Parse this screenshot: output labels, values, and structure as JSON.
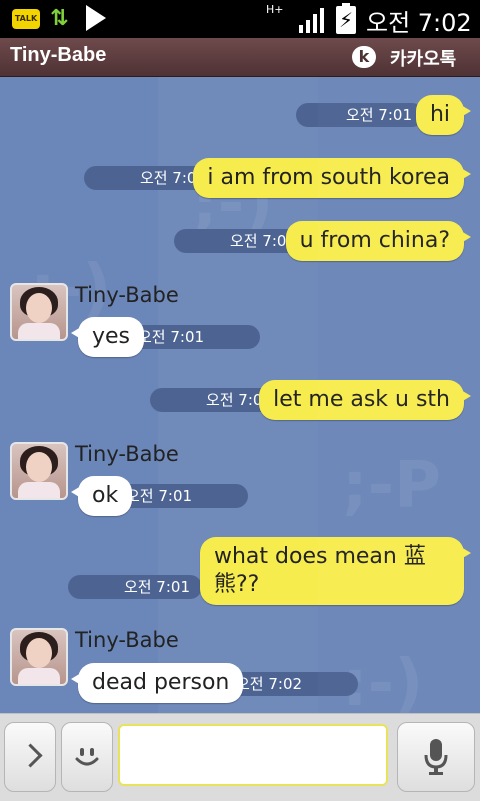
{
  "status_bar": {
    "talk_label": "TALK",
    "network": "H+",
    "time": "오전 7:02",
    "icons": [
      "kakaotalk-notification-icon",
      "sync-icon",
      "play-icon",
      "network-type-icon",
      "signal-icon",
      "battery-charging-icon"
    ]
  },
  "header": {
    "title": "Tiny-Babe",
    "brand": "카카오톡",
    "brand_icon": "kakao-logo-icon"
  },
  "watermarks": [
    ";-)",
    ";-)",
    ";-P",
    ":-)"
  ],
  "messages": [
    {
      "dir": "sent",
      "text": "hi",
      "time": "오전 7:01"
    },
    {
      "dir": "sent",
      "text": "i am from south korea",
      "time": "오전 7:01"
    },
    {
      "dir": "sent",
      "text": "u from china?",
      "time": "오전 7:01"
    },
    {
      "dir": "received",
      "sender": "Tiny-Babe",
      "text": "yes",
      "time": "오전 7:01"
    },
    {
      "dir": "sent",
      "text": "let me ask u sth",
      "time": "오전 7:01"
    },
    {
      "dir": "received",
      "sender": "Tiny-Babe",
      "text": "ok",
      "time": "오전 7:01"
    },
    {
      "dir": "sent",
      "text": "what does mean 蓝\n熊??",
      "time": "오전 7:01"
    },
    {
      "dir": "received",
      "sender": "Tiny-Babe",
      "text": "dead person",
      "time": "오전 7:02"
    }
  ],
  "input_bar": {
    "more_icon": "chevron-right-icon",
    "emoji_icon": "smiley-icon",
    "voice_icon": "microphone-icon",
    "message_value": ""
  },
  "colors": {
    "chat_background": "#6b86b8",
    "sent_bubble": "#f7ec4e",
    "received_bubble": "#ffffff",
    "time_pill": "#4d6493",
    "title_bar": "#5e3e40",
    "status_bar": "#000000"
  }
}
